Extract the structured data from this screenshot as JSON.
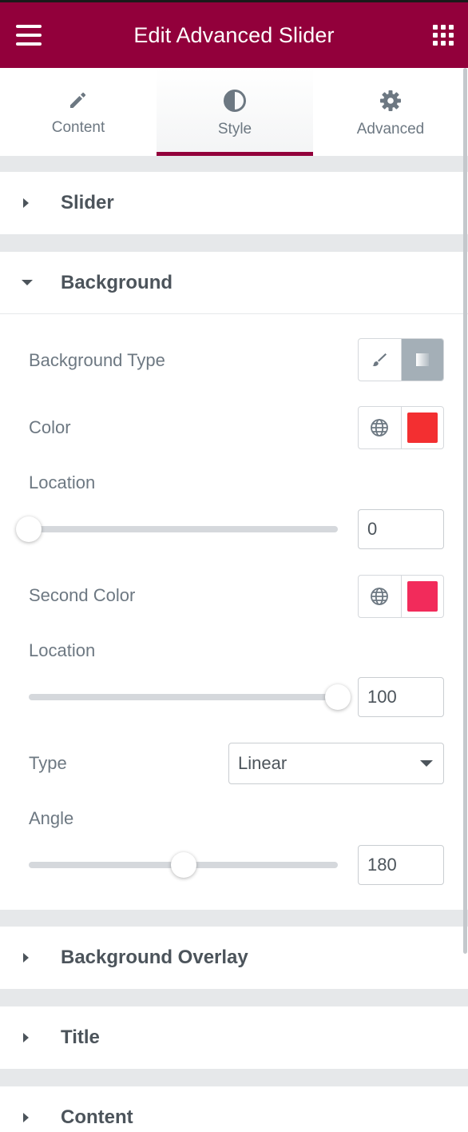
{
  "header": {
    "title": "Edit Advanced Slider",
    "menu_icon": "hamburger-menu-icon",
    "apps_icon": "grid-apps-icon",
    "brand_color": "#92003b"
  },
  "tabs": [
    {
      "label": "Content",
      "icon": "pencil-icon",
      "active": false
    },
    {
      "label": "Style",
      "icon": "half-circle-contrast-icon",
      "active": true
    },
    {
      "label": "Advanced",
      "icon": "gear-icon",
      "active": false
    }
  ],
  "sections": {
    "slider": {
      "title": "Slider",
      "expanded": false
    },
    "background": {
      "title": "Background",
      "expanded": true,
      "background_type_label": "Background Type",
      "background_type_options": [
        "brush-icon",
        "gradient-icon"
      ],
      "background_type_selected": "gradient",
      "color_label": "Color",
      "color_value": "#f32f31",
      "location_label": "Location",
      "location_value": "0",
      "second_color_label": "Second Color",
      "second_color_value": "#f22b5b",
      "location2_label": "Location",
      "location2_value": "100",
      "type_label": "Type",
      "type_value": "Linear",
      "angle_label": "Angle",
      "angle_value": "180",
      "angle_max": 360
    },
    "background_overlay": {
      "title": "Background Overlay",
      "expanded": false
    },
    "title": {
      "title": "Title",
      "expanded": false
    },
    "content": {
      "title": "Content",
      "expanded": false
    }
  }
}
